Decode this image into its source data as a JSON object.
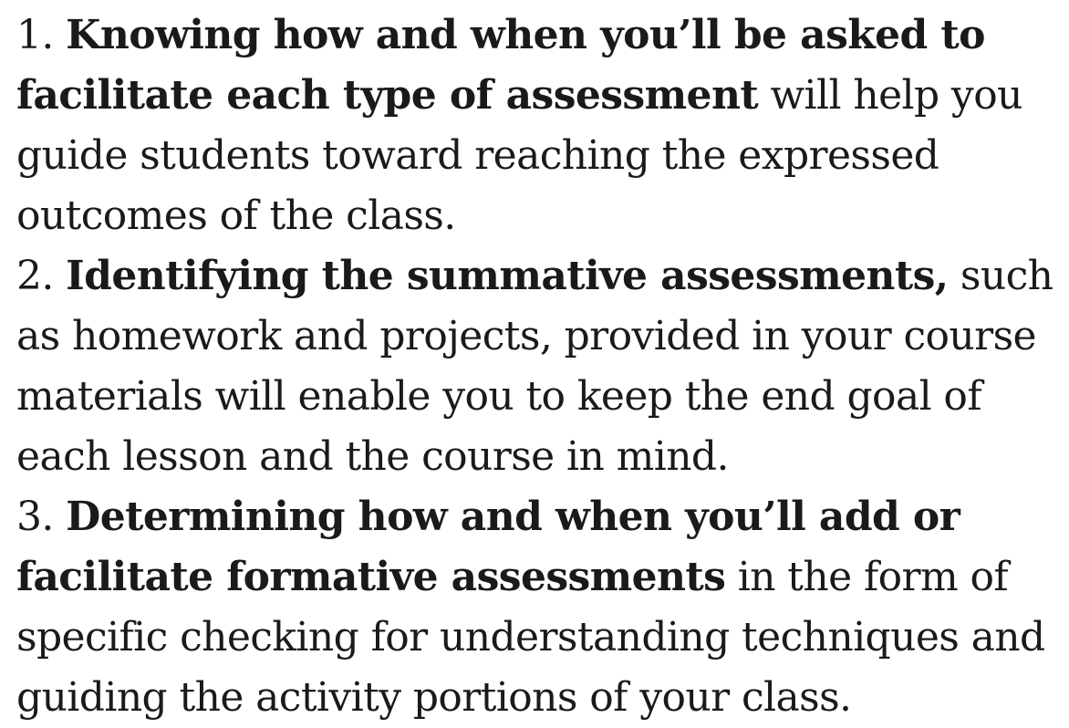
{
  "items": [
    {
      "number": "1.",
      "lead": "Knowing how and when you’ll be asked to facilitate each type of assessment",
      "rest": " will help you guide students toward reaching the expressed outcomes of the class."
    },
    {
      "number": "2.",
      "lead": "Identifying the summative assessments,",
      "rest": " such as homework and projects, provided in your course materials will enable you to keep the end goal of each lesson and the course in mind."
    },
    {
      "number": "3.",
      "lead": "Determining how and when you’ll add or facilitate formative assessments",
      "rest": " in the form of specific checking for understanding techniques and guiding the activity portions of your class."
    }
  ]
}
